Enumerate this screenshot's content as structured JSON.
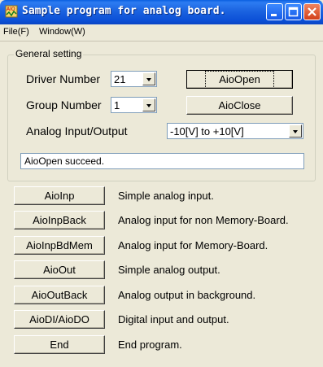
{
  "window": {
    "title": "Sample program for analog board.",
    "icon": "aio-app-icon",
    "controls": [
      "minimize-icon",
      "maximize-icon",
      "close-icon"
    ]
  },
  "menu": [
    {
      "label": "File(F)"
    },
    {
      "label": "Window(W)"
    }
  ],
  "general_setting": {
    "legend": "General setting",
    "driver_number_label": "Driver Number",
    "driver_number_value": "21",
    "group_number_label": "Group Number",
    "group_number_value": "1",
    "analog_io_label": "Analog Input/Output",
    "analog_io_value": "-10[V] to +10[V]",
    "aio_open_button": "AioOpen",
    "aio_close_button": "AioClose",
    "status_text": "AioOpen succeed."
  },
  "actions": [
    {
      "button": "AioInp",
      "description": "Simple analog input."
    },
    {
      "button": "AioInpBack",
      "description": "Analog input for non Memory-Board."
    },
    {
      "button": "AioInpBdMem",
      "description": "Analog input for Memory-Board."
    },
    {
      "button": "AioOut",
      "description": "Simple analog output."
    },
    {
      "button": "AioOutBack",
      "description": "Analog output in background."
    },
    {
      "button": "AioDI/AioDO",
      "description": "Digital input and output."
    },
    {
      "button": "End",
      "description": "End program."
    }
  ],
  "colors": {
    "titlebar": "#0a4fd6",
    "face": "#ece9d8",
    "close_button": "#d2401a"
  }
}
